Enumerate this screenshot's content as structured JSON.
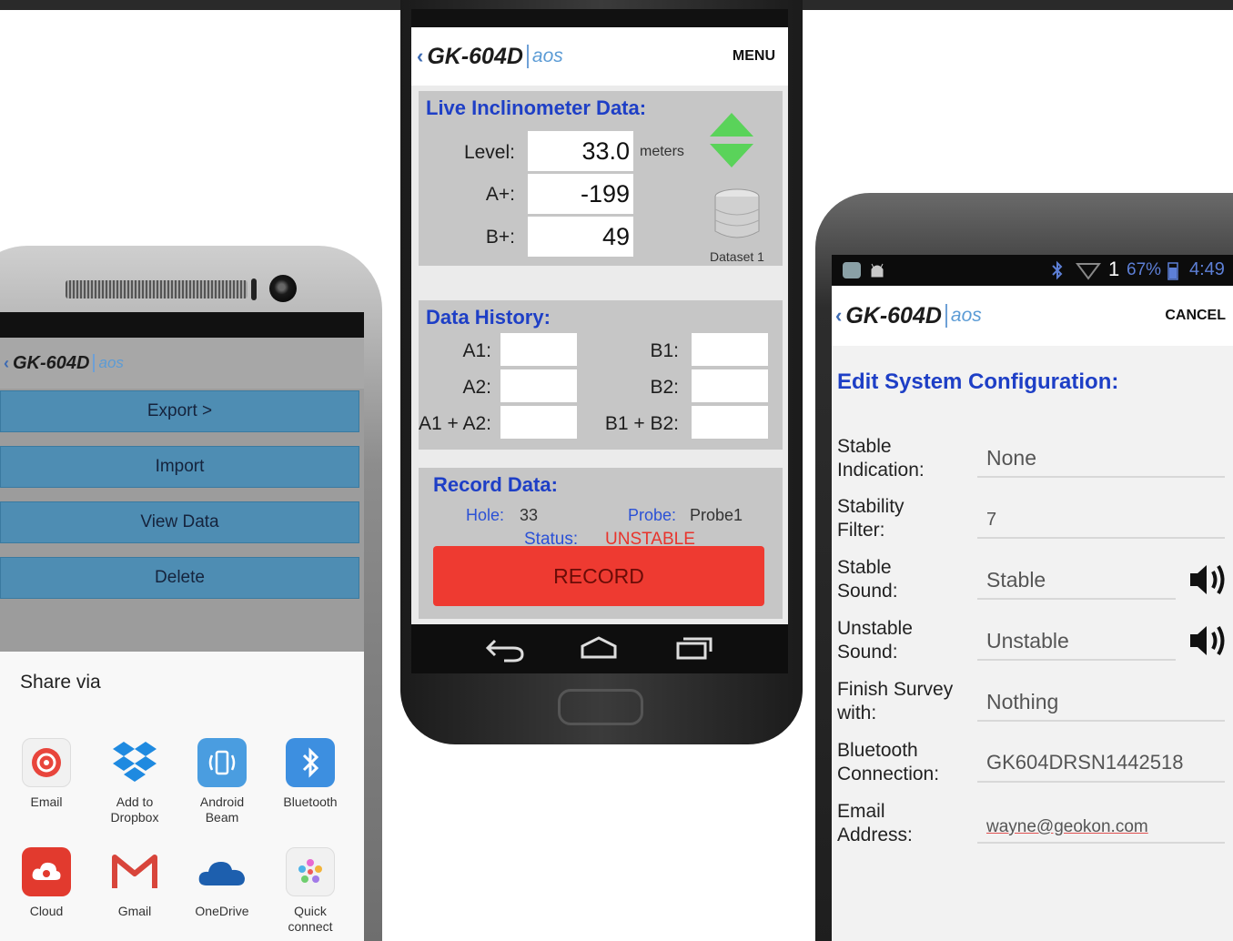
{
  "left_phone": {
    "app_title": "GK-604D",
    "app_subtitle": "aos",
    "menu_items": [
      {
        "label": "Export >"
      },
      {
        "label": "Import"
      },
      {
        "label": "View Data"
      },
      {
        "label": "Delete"
      }
    ],
    "share": {
      "title": "Share via",
      "targets": [
        {
          "label": "Email",
          "icon": "email-icon"
        },
        {
          "label": "Add to\nDropbox",
          "icon": "dropbox-icon"
        },
        {
          "label": "Android\nBeam",
          "icon": "android-beam-icon"
        },
        {
          "label": "Bluetooth",
          "icon": "bluetooth-icon"
        },
        {
          "label": "Cloud",
          "icon": "cloud-icon"
        },
        {
          "label": "Gmail",
          "icon": "gmail-icon"
        },
        {
          "label": "OneDrive",
          "icon": "onedrive-icon"
        },
        {
          "label": "Quick\nconnect",
          "icon": "quick-connect-icon"
        }
      ]
    }
  },
  "center_phone": {
    "app_title": "GK-604D",
    "app_subtitle": "aos",
    "menu_label": "MENU",
    "live": {
      "title": "Live Inclinometer Data:",
      "level_label": "Level:",
      "level_value": "33.0",
      "level_unit": "meters",
      "a_label": "A+:",
      "a_value": "-199",
      "b_label": "B+:",
      "b_value": "49",
      "dataset_label": "Dataset 1"
    },
    "history": {
      "title": "Data History:",
      "a1_label": "A1:",
      "a2_label": "A2:",
      "a1a2_label": "A1 + A2:",
      "b1_label": "B1:",
      "b2_label": "B2:",
      "b1b2_label": "B1 + B2:"
    },
    "record": {
      "title": "Record Data:",
      "hole_label": "Hole:",
      "hole_value": "33",
      "probe_label": "Probe:",
      "probe_value": "Probe1",
      "status_label": "Status:",
      "status_value": "UNSTABLE",
      "button_label": "RECORD"
    }
  },
  "right_phone": {
    "status_bar": {
      "signal_number": "1",
      "battery": "67%",
      "time": "4:49"
    },
    "app_title": "GK-604D",
    "app_subtitle": "aos",
    "cancel_label": "CANCEL",
    "title": "Edit System Configuration:",
    "fields": [
      {
        "label": "Stable\nIndication:",
        "value": "None"
      },
      {
        "label": "Stability\nFilter:",
        "value": "7"
      },
      {
        "label": "Stable\nSound:",
        "value": "Stable"
      },
      {
        "label": "Unstable\nSound:",
        "value": "Unstable"
      },
      {
        "label": "Finish Survey\nwith:",
        "value": "Nothing"
      },
      {
        "label": "Bluetooth\nConnection:",
        "value": "GK604DRSN1442518"
      },
      {
        "label": "Email\nAddress:",
        "value": "wayne@geokon.com"
      }
    ]
  },
  "colors": {
    "brand_blue": "#1e3fc6",
    "menu_button_blue": "#4e8db3",
    "record_red": "#ee3a31",
    "arrow_green": "#5ad35a",
    "unstable_red": "#e8342c"
  }
}
